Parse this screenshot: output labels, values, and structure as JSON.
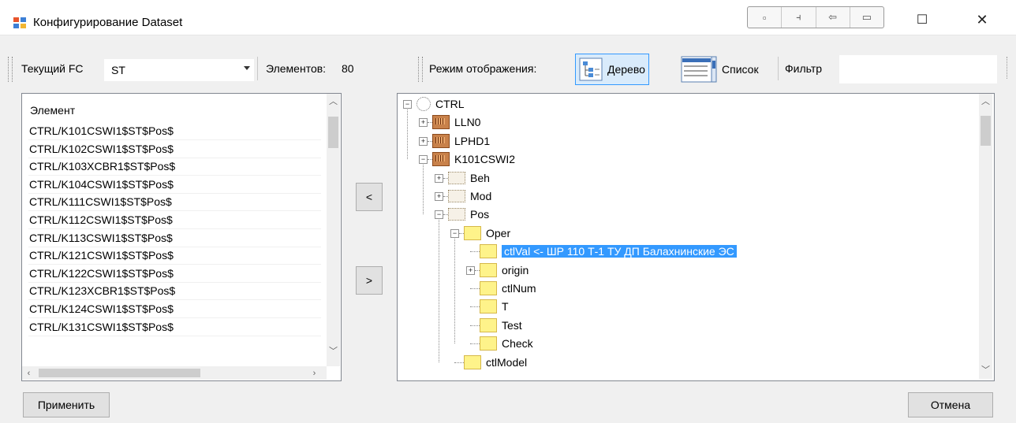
{
  "window": {
    "title": "Конфигурирование Dataset",
    "minimize_glyph": "—",
    "maximize_glyph": "☐",
    "close_glyph": "✕",
    "extra_buttons": [
      "▫",
      "⫞",
      "⇦",
      "▭"
    ]
  },
  "toolbar": {
    "fc_label": "Текущий FC",
    "fc_value": "ST",
    "count_label": "Элементов:",
    "count_value": "80",
    "mode_label": "Режим отображения:",
    "mode_tree": "Дерево",
    "mode_list": "Список",
    "filter_label": "Фильтр",
    "filter_value": ""
  },
  "left_list": {
    "header": "Элемент",
    "items": [
      "CTRL/K101CSWI1$ST$Pos$",
      "CTRL/K102CSWI1$ST$Pos$",
      "CTRL/K103XCBR1$ST$Pos$",
      "CTRL/K104CSWI1$ST$Pos$",
      "CTRL/K111CSWI1$ST$Pos$",
      "CTRL/K112CSWI1$ST$Pos$",
      "CTRL/K113CSWI1$ST$Pos$",
      "CTRL/K121CSWI1$ST$Pos$",
      "CTRL/K122CSWI1$ST$Pos$",
      "CTRL/K123XCBR1$ST$Pos$",
      "CTRL/K124CSWI1$ST$Pos$",
      "CTRL/K131CSWI1$ST$Pos$"
    ]
  },
  "transfer": {
    "left": "<",
    "right": ">"
  },
  "tree": {
    "nodes": [
      "CTRL",
      "LLN0",
      "LPHD1",
      "K101CSWI2",
      "Beh",
      "Mod",
      "Pos",
      "Oper",
      "ctlVal <- ШР 110 Т-1   ТУ ДП Балахнинские ЭС",
      "origin",
      "ctlNum",
      "T",
      "Test",
      "Check",
      "ctlModel"
    ]
  },
  "buttons": {
    "apply": "Применить",
    "cancel": "Отмена"
  },
  "colors": {
    "selection": "#3399ff",
    "accent_border": "#3399ff"
  }
}
